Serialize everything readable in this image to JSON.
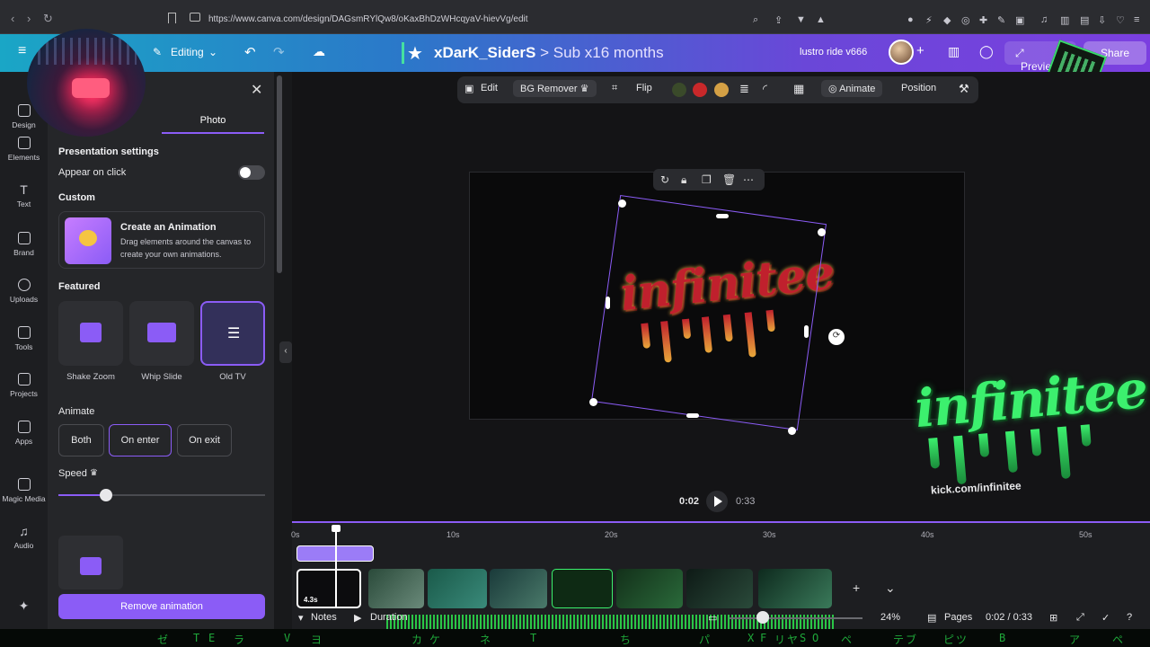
{
  "browser": {
    "url": "https://www.canva.com/design/DAGsmRYlQw8/oKaxBhDzWHcqyaV-hievVg/edit"
  },
  "topbar": {
    "mode": "Editing",
    "title": "xDarK_SiderS",
    "subtitle": "> Sub x16 months",
    "team": "lustro ride v666",
    "plus": "+",
    "preview": "Preview",
    "share": "Share"
  },
  "rail": {
    "items": [
      "Design",
      "Elements",
      "Text",
      "Brand",
      "Uploads",
      "Tools",
      "Projects",
      "Apps",
      "Magic Media",
      "Audio"
    ]
  },
  "panel": {
    "tab": "Photo",
    "presentation_heading": "Presentation settings",
    "appear_on_click": "Appear on click",
    "appear_on_click_on": false,
    "custom_heading": "Custom",
    "custom_title": "Create an Animation",
    "custom_desc_1": "Drag elements around the canvas to",
    "custom_desc_2": "create your own animations.",
    "featured_heading": "Featured",
    "featured": [
      {
        "label": "Shake Zoom",
        "selected": false
      },
      {
        "label": "Whip Slide",
        "selected": false
      },
      {
        "label": "Old TV",
        "selected": true
      }
    ],
    "animate_heading": "Animate",
    "animate_options": [
      {
        "label": "Both",
        "selected": false
      },
      {
        "label": "On enter",
        "selected": true
      },
      {
        "label": "On exit",
        "selected": false
      }
    ],
    "speed_label": "Speed",
    "speed_value": 0.23,
    "remove_button": "Remove animation"
  },
  "toolbar": {
    "edit": "Edit",
    "bg_remover": "BG Remover",
    "flip": "Flip",
    "animate": "Animate",
    "position": "Position",
    "colors": [
      "#3a4a2a",
      "#c8282a",
      "#d4a045"
    ]
  },
  "canvas": {
    "logo_text": "infinitee"
  },
  "overlay": {
    "logo_text": "infinitee",
    "url": "kick.com/infinitee"
  },
  "playback": {
    "current": "0:02",
    "total": "0:33"
  },
  "timeline": {
    "ruler": [
      "0s",
      "10s",
      "20s",
      "30s",
      "40s",
      "50s"
    ],
    "first_clip_duration": "4.3s"
  },
  "bottombar": {
    "notes": "Notes",
    "duration": "Duration",
    "zoom": "24%",
    "pages": "Pages",
    "page_time": "0:02 / 0:33"
  },
  "matrix_glyphs": [
    "ゼ",
    "T",
    "E",
    "ラ",
    "V",
    "ヨ",
    "カ",
    "ケ",
    "ネ",
    "T",
    "ち",
    "パ",
    "X",
    "F",
    "リ",
    "ヤ",
    "S",
    "O",
    "ペ",
    "テ",
    "ブ",
    "ピ",
    "ツ",
    "B",
    "ア",
    "ペ"
  ]
}
